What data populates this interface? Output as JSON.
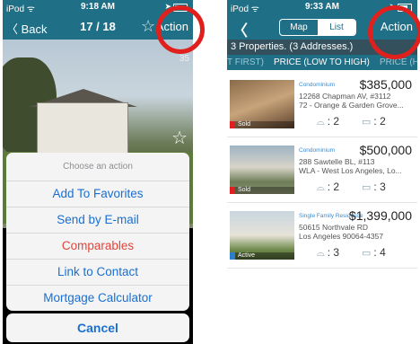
{
  "left": {
    "status": {
      "carrier": "iPod ᯤ",
      "time": "9:18 AM"
    },
    "nav": {
      "back": "〈 Back",
      "counter": "17 / 18",
      "action": "Action"
    },
    "photo_counter": "35",
    "sheet": {
      "title": "Choose an action",
      "options": [
        "Add To Favorites",
        "Send by E-mail",
        "Comparables",
        "Link to Contact",
        "Mortgage Calculator"
      ],
      "cancel": "Cancel"
    }
  },
  "right": {
    "status": {
      "carrier": "iPod ᯤ",
      "time": "9:33 AM"
    },
    "nav": {
      "back": "〈",
      "segments": [
        "Map",
        "List"
      ],
      "selected": "List",
      "action": "Action"
    },
    "summary": "3 Properties. (3 Addresses.)",
    "sort": {
      "prev": "T FIRST)",
      "current": "PRICE (LOW TO HIGH)",
      "next": "PRICE (H"
    },
    "listings": [
      {
        "type": "Condominium",
        "price": "$385,000",
        "address1": "12268 Chapman AV, #3112",
        "address2": "72 - Orange & Garden Grove...",
        "beds": "2",
        "baths": "2",
        "status": "Sold"
      },
      {
        "type": "Condominium",
        "price": "$500,000",
        "address1": "288  Sawtelle BL, #113",
        "address2": "WLA - West Los Angeles, Lo...",
        "beds": "2",
        "baths": "3",
        "status": "Sold"
      },
      {
        "type": "Single Family Residence",
        "price": "$1,399,000",
        "address1": "50615 Northvale RD",
        "address2": "Los Angeles 90064-4357",
        "beds": "3",
        "baths": "4",
        "status": "Active"
      }
    ]
  },
  "colors": {
    "nav": "#1f6f86",
    "link": "#1a6fd1",
    "destructive": "#e2443a",
    "highlight": "#e0201c"
  }
}
